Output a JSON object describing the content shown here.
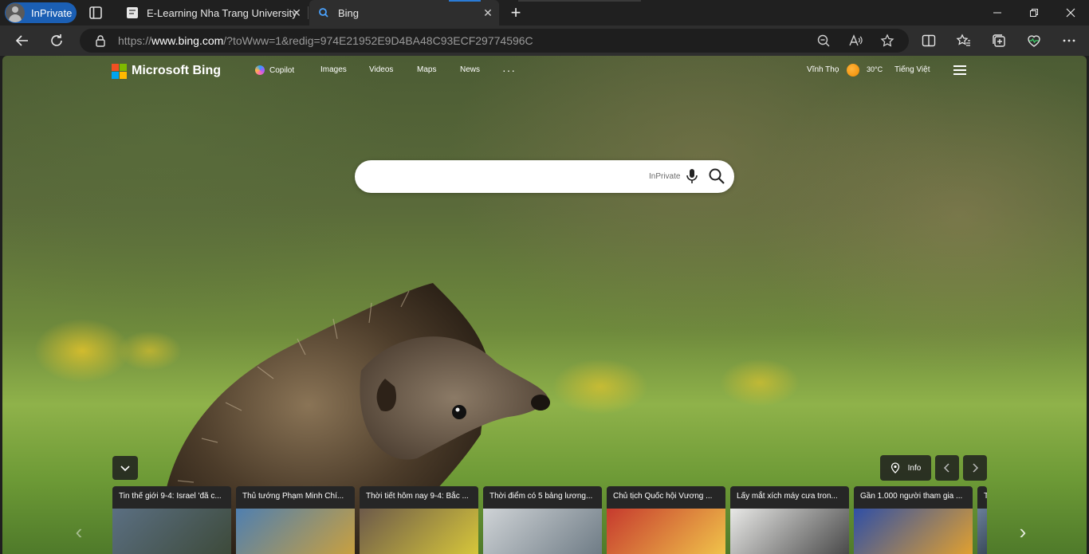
{
  "browser": {
    "profile_label": "InPrivate",
    "tabs": [
      {
        "title": "E-Learning Nha Trang University"
      },
      {
        "title": "Bing"
      }
    ],
    "url_prefix": "https://",
    "url_host": "www.bing.com",
    "url_rest": "/?toWww=1&redig=974E21952E9D4BA48C93ECF29774596C"
  },
  "bing": {
    "logo_text": "Microsoft Bing",
    "nav": [
      "Copilot",
      "Images",
      "Videos",
      "Maps",
      "News"
    ],
    "more": "···",
    "location": "Vĩnh Thọ",
    "temperature": "30°C",
    "language": "Tiếng Việt",
    "search": {
      "value": "",
      "placeholder": "",
      "inprivate_label": "InPrivate"
    },
    "info_label": "Info"
  },
  "news": [
    {
      "title": "Tin thế giới 9-4: Israel 'đã c...",
      "colors": [
        "#5b6f82",
        "#3d4a3a"
      ]
    },
    {
      "title": "Thủ tướng Phạm Minh Chí...",
      "colors": [
        "#4f7fb0",
        "#c8a040"
      ]
    },
    {
      "title": "Thời tiết hôm nay 9-4: Bắc ...",
      "colors": [
        "#6d5a4a",
        "#d6c63a"
      ]
    },
    {
      "title": "Thời điểm có 5 bảng lương...",
      "colors": [
        "#cfd3d6",
        "#6f7c86"
      ]
    },
    {
      "title": "Chủ tịch Quốc hội Vương ...",
      "colors": [
        "#c63a2e",
        "#f0c34a"
      ]
    },
    {
      "title": "Lấy mắt xích máy cưa tron...",
      "colors": [
        "#e8e8e6",
        "#4a4a4a"
      ]
    },
    {
      "title": "Gần 1.000 người tham gia ...",
      "colors": [
        "#2f4fa6",
        "#e0a030"
      ]
    },
    {
      "title": "T",
      "colors": [
        "#6a7f9a",
        "#3a4a5a"
      ]
    }
  ],
  "colors": {
    "inprivate_blue": "#1b5fb4",
    "tab_accent": "#2a7bd6"
  }
}
